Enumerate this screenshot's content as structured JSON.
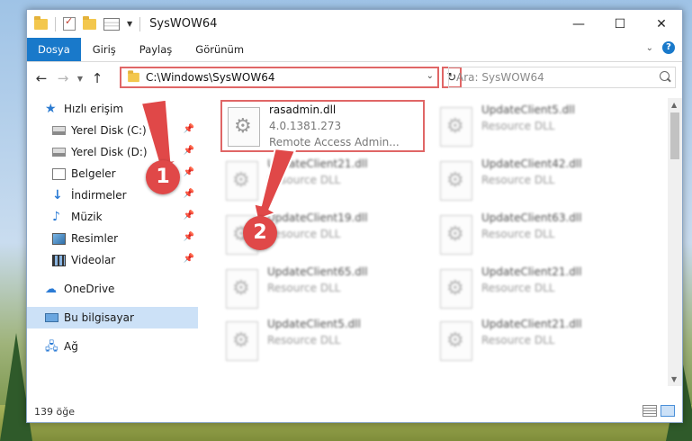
{
  "window": {
    "title": "SysWOW64"
  },
  "controls": {
    "minimize": "—",
    "maximize": "☐",
    "close": "✕"
  },
  "ribbon": {
    "tabs": [
      {
        "label": "Dosya"
      },
      {
        "label": "Giriş"
      },
      {
        "label": "Paylaş"
      },
      {
        "label": "Görünüm"
      }
    ],
    "help": "?"
  },
  "navigation": {
    "address": "C:\\Windows\\SysWOW64",
    "search_placeholder": "Ara: SysWOW64"
  },
  "sidebar": {
    "quick_access": "Hızlı erişim",
    "pinned": [
      {
        "label": "Yerel Disk (C:)",
        "icon": "drive-icon"
      },
      {
        "label": "Yerel Disk (D:)",
        "icon": "drive-icon"
      },
      {
        "label": "Belgeler",
        "icon": "documents-icon"
      },
      {
        "label": "İndirmeler",
        "icon": "downloads-icon"
      },
      {
        "label": "Müzik",
        "icon": "music-icon"
      },
      {
        "label": "Resimler",
        "icon": "pictures-icon"
      },
      {
        "label": "Videolar",
        "icon": "videos-icon"
      }
    ],
    "onedrive": "OneDrive",
    "this_pc": "Bu bilgisayar",
    "network": "Ağ"
  },
  "files": {
    "highlighted": {
      "name": "rasadmin.dll",
      "version": "4.0.1381.273",
      "description": "Remote Access Admin..."
    },
    "others": [
      {
        "name": "UpdateClient5.dll",
        "type": "Resource DLL"
      },
      {
        "name": "UpdateClient21.dll",
        "type": "Resource DLL"
      },
      {
        "name": "UpdateClient42.dll",
        "type": "Resource DLL"
      },
      {
        "name": "UpdateClient19.dll",
        "type": "Resource DLL"
      },
      {
        "name": "UpdateClient63.dll",
        "type": "Resource DLL"
      },
      {
        "name": "UpdateClient65.dll",
        "type": "Resource DLL"
      },
      {
        "name": "UpdateClient21.dll",
        "type": "Resource DLL"
      },
      {
        "name": "UpdateClient5.dll",
        "type": "Resource DLL"
      },
      {
        "name": "UpdateClient21.dll",
        "type": "Resource DLL"
      }
    ]
  },
  "status": {
    "item_count": "139 öğe"
  },
  "annotations": {
    "step1": "1",
    "step2": "2",
    "color": "#e04848"
  }
}
